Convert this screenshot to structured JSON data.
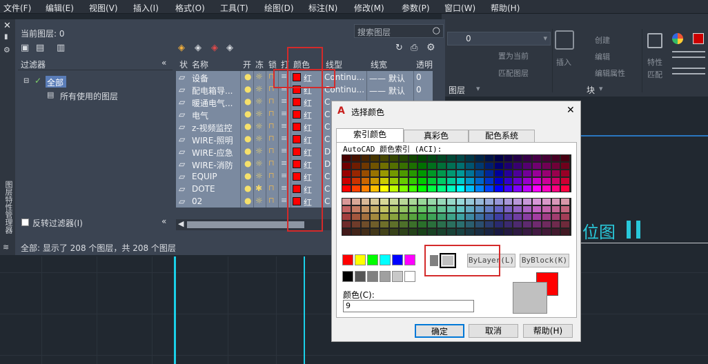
{
  "menubar": [
    "文件(F)",
    "编辑(E)",
    "视图(V)",
    "插入(I)",
    "格式(O)",
    "工具(T)",
    "绘图(D)",
    "标注(N)",
    "修改(M)",
    "参数(P)",
    "窗口(W)",
    "帮助(H)"
  ],
  "ribbon": {
    "create": "创建",
    "edit": "编辑",
    "set_current": "置为当前",
    "match_layer": "匹配图层",
    "edit_attr": "编辑属性",
    "insert": "插入",
    "layer": "图层",
    "block": "块",
    "props_a": "特性",
    "props_b": "匹配",
    "combo_value": "0"
  },
  "canvas_text": "位图",
  "layer_manager": {
    "side_title": "图层特性管理器",
    "current_layer": "当前图层: 0",
    "search_placeholder": "搜索图层",
    "filters_title": "过滤器",
    "filter_all": "全部",
    "filter_used": "所有使用的图层",
    "invert_filter": "反转过滤器(I)",
    "status": "全部: 显示了 208 个图层，共 208 个图层",
    "columns": [
      "状",
      "名称",
      "开",
      "冻",
      "锁",
      "打",
      "颜色",
      "线型",
      "线宽",
      "透明"
    ],
    "rows": [
      {
        "name": "设备",
        "color": "红",
        "linetype": "Continu...",
        "lineweight": "—— 默认",
        "transparency": "0"
      },
      {
        "name": "配电箱导...",
        "color": "红",
        "linetype": "Continu...",
        "lineweight": "—— 默认",
        "transparency": "0"
      },
      {
        "name": "暖通电气...",
        "color": "红",
        "linetype": "C",
        "lineweight": "",
        "transparency": ""
      },
      {
        "name": "电气",
        "color": "红",
        "linetype": "C",
        "lineweight": "",
        "transparency": ""
      },
      {
        "name": "z-视频监控",
        "color": "红",
        "linetype": "C",
        "lineweight": "",
        "transparency": ""
      },
      {
        "name": "WIRE-照明",
        "color": "红",
        "linetype": "C",
        "lineweight": "",
        "transparency": ""
      },
      {
        "name": "WIRE-应急",
        "color": "红",
        "linetype": "D",
        "lineweight": "",
        "transparency": ""
      },
      {
        "name": "WIRE-消防",
        "color": "红",
        "linetype": "D",
        "lineweight": "",
        "transparency": ""
      },
      {
        "name": "EQUIP",
        "color": "红",
        "linetype": "C",
        "lineweight": "",
        "transparency": ""
      },
      {
        "name": "DOTE",
        "color": "红",
        "linetype": "C",
        "lineweight": "",
        "transparency": ""
      },
      {
        "name": "02",
        "color": "红",
        "linetype": "C",
        "lineweight": "",
        "transparency": ""
      }
    ]
  },
  "dialog": {
    "title": "选择颜色",
    "tabs": [
      "索引颜色",
      "真彩色",
      "配色系统"
    ],
    "aci_label": "AutoCAD 颜色索引 (ACI):",
    "bylayer": "ByLayer(L)",
    "byblock": "ByBlock(K)",
    "color_label": "颜色(C):",
    "color_value": "9",
    "ok": "确定",
    "cancel": "取消",
    "help": "帮助(H)",
    "old_color": "#ff0000",
    "new_color": "#c0c0c0"
  },
  "colors": {
    "accent_red": "#d42a2a",
    "layer_red": "#ff0000",
    "row_bg": "#7b8aa0"
  }
}
